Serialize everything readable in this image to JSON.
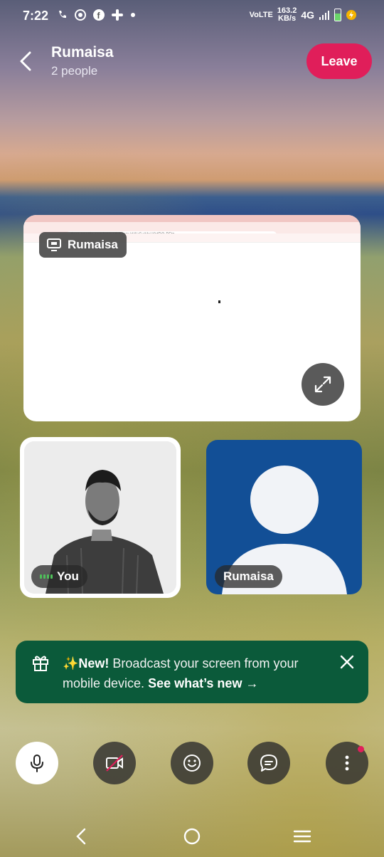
{
  "status_bar": {
    "time": "7:22",
    "network": "VoLTE",
    "speed_value": "163.2",
    "speed_unit": "KB/s",
    "signal": "4G",
    "notif_icons": [
      "phone-wifi-icon",
      "whatsapp-icon",
      "facebook-icon",
      "slack-icon",
      "dot-icon"
    ]
  },
  "header": {
    "title": "Rumaisa",
    "subtitle": "2 people",
    "leave_label": "Leave"
  },
  "screen_share": {
    "presenter_label": "Rumaisa",
    "url_text": "docs.google.com/spreadsheets/d/1kGeMnH8dRO-B5tz..."
  },
  "participants": [
    {
      "name": "You",
      "kind": "self-camera"
    },
    {
      "name": "Rumaisa",
      "kind": "avatar"
    }
  ],
  "banner": {
    "new_label": "✨New!",
    "message": " Broadcast your screen from your mobile device. ",
    "link_label": "See what’s new →"
  },
  "controls": [
    "microphone",
    "camera-off",
    "reactions",
    "chat",
    "more-options"
  ],
  "colors": {
    "leave_button": "#e01e5a",
    "banner_bg": "#0b5a3a",
    "avatar_bg": "#124f96",
    "notification_dot": "#e01e5a"
  }
}
